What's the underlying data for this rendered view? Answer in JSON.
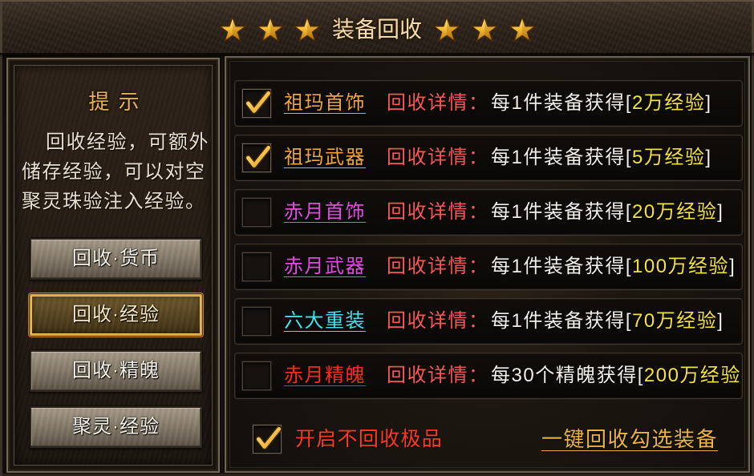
{
  "header": {
    "title": "装备回收",
    "decoration_icon": "star-icon"
  },
  "tips": {
    "title": "提 示",
    "lines": [
      "回收经验，可额外",
      "储存经验，可以对空",
      "聚灵珠验注入经验。"
    ]
  },
  "menu": [
    {
      "label": "回收·货币",
      "selected": false
    },
    {
      "label": "回收·经验",
      "selected": true
    },
    {
      "label": "回收·精魄",
      "selected": false
    },
    {
      "label": "聚灵·经验",
      "selected": false
    }
  ],
  "recycle_rows": [
    {
      "checked": true,
      "name": "祖玛首饰",
      "name_color": "#f2a53c",
      "detail_label": "回收详情：",
      "reward_prefix": "每1件装备获得[",
      "reward_value": "2万经验",
      "reward_suffix": "]"
    },
    {
      "checked": true,
      "name": "祖玛武器",
      "name_color": "#f2a53c",
      "detail_label": "回收详情：",
      "reward_prefix": "每1件装备获得[",
      "reward_value": "5万经验",
      "reward_suffix": "]"
    },
    {
      "checked": false,
      "name": "赤月首饰",
      "name_color": "#e24be4",
      "detail_label": "回收详情：",
      "reward_prefix": "每1件装备获得[",
      "reward_value": "20万经验",
      "reward_suffix": "]"
    },
    {
      "checked": false,
      "name": "赤月武器",
      "name_color": "#e24be4",
      "detail_label": "回收详情：",
      "reward_prefix": "每1件装备获得[",
      "reward_value": "100万经验",
      "reward_suffix": "]"
    },
    {
      "checked": false,
      "name": "六大重装",
      "name_color": "#3fe3f0",
      "detail_label": "回收详情：",
      "reward_prefix": "每1件装备获得[",
      "reward_value": "70万经验",
      "reward_suffix": "]"
    },
    {
      "checked": false,
      "name": "赤月精魄",
      "name_color": "#ff2a1c",
      "detail_label": "回收详情：",
      "reward_prefix": "每30个精魄获得[",
      "reward_value": "200万经验"
    }
  ],
  "footer": {
    "keep_rare_checked": true,
    "keep_rare_label": "开启不回收极品",
    "recycle_all_label": "一键回收勾选装备"
  },
  "icons": {
    "checkbox_mark": "checkmark-icon"
  },
  "colors": {
    "title": "#f2dcae",
    "tips_title": "#e4b45a",
    "detail_label": "#ff5656",
    "reward_text": "#f2efe8",
    "reward_value": "#f4e33c",
    "keep_rare_label": "#ff3a22",
    "recycle_all_label": "#e9b345"
  }
}
